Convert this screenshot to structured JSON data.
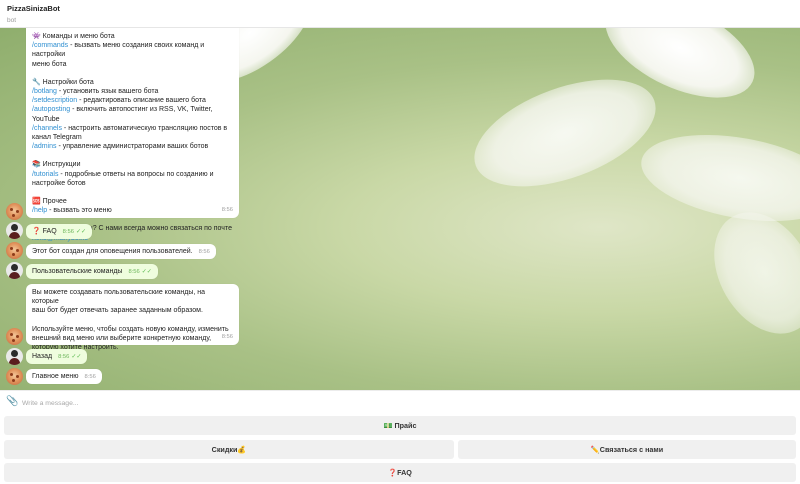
{
  "header": {
    "title": "PizzaSinizaBot",
    "subtitle": "bot"
  },
  "messages": {
    "menu": {
      "l1": "Команды и меню бота",
      "l2cmd": "/commands",
      "l2": " - вызвать меню создания своих команд и настройки",
      "l3": "меню бота",
      "l4": "Настройки бота",
      "l5cmd": "/botlang",
      "l5": " - установить язык вашего бота",
      "l6cmd": "/setdescription",
      "l6": " - редактировать описание вашего бота",
      "l7cmd": "/autoposting",
      "l7": " - включить автопостинг из RSS, VK, Twitter, YouTube",
      "l8cmd": "/channels",
      "l8": " - настроить автоматическую трансляцию постов в",
      "l9": "канал Telegram",
      "l10cmd": "/admins",
      "l10": " - управление администраторами ваших ботов",
      "l11": "Инструкции",
      "l12cmd": "/tutorials",
      "l12": " - подробные ответы на вопросы по созданию и",
      "l13": "настройке ботов",
      "l14": "Прочее",
      "l15cmd": "/help",
      "l15": " - вызвать это меню",
      "l16": "Остались вопросы? С нами всегда можно связаться по почте",
      "email": "hello@manybot.io",
      "time": "8:56"
    },
    "faq": {
      "text": "❓ FAQ",
      "time": "8:56"
    },
    "notify": {
      "text": "Этот бот создан для оповещения пользователей.",
      "time": "8:56"
    },
    "custom_cmd": {
      "text": "Пользовательские команды",
      "time": "8:56"
    },
    "custom_info": {
      "l1": "Вы можете создавать пользовательские команды, на которые",
      "l2": "ваш бот будет отвечать заранее заданным образом.",
      "l3": "Используйте меню, чтобы создать новую команду, изменить",
      "l4": "внешний вид меню или выберите конкретную команду,",
      "l5": "которую хотите настроить.",
      "time": "8:56"
    },
    "back": {
      "text": "Назад",
      "time": "8:56"
    },
    "main_menu": {
      "text": "Главное меню",
      "time": "8:56"
    }
  },
  "icons": {
    "commands": "👾",
    "settings": "🔧",
    "instructions": "📚",
    "other": "🆘",
    "checkmarks": "✓✓",
    "attach": "📎"
  },
  "input": {
    "placeholder": "Write a message..."
  },
  "keyboard": {
    "price": "💵 Прайс",
    "discounts": "Скидки💰",
    "contact": "✏️Связаться с нами",
    "faq": "❓FAQ"
  },
  "colors": {
    "link": "#2f8fd1",
    "outgoing_bubble": "#effdde",
    "check": "#5dbb53"
  }
}
